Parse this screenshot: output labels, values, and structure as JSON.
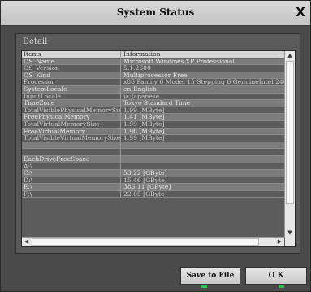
{
  "window": {
    "title": "System Status",
    "close_glyph": "X"
  },
  "panel": {
    "label": "Detail"
  },
  "table": {
    "headers": [
      "Items",
      "Information"
    ],
    "rows": [
      [
        "OS_Name",
        "Microsoft Windows XP Professional"
      ],
      [
        "OS_Version",
        "5.1.2600"
      ],
      [
        "OS_Kind",
        "Multiprocessor Free"
      ],
      [
        "Processor",
        "x86 Family 6 Model 15 Stepping 6 GenuineIntel 2400 Mhz"
      ],
      [
        "SystemLocale",
        "en;English"
      ],
      [
        "InputLocale",
        "ja;Japanese"
      ],
      [
        "TimeZone",
        "Tokyo Standard Time"
      ],
      [
        "TotalVisiblePhysicalMemorySize",
        "1.99 [MByte]"
      ],
      [
        "FreePhysicalMemory",
        "1.41 [MByte]"
      ],
      [
        "TotalVirtualMemorySize",
        "1.99 [MByte]"
      ],
      [
        "FreeVirtualMemory",
        "1.96 [MByte]"
      ],
      [
        "TotalVisibleVirtualMemorySize",
        "1.99 [MByte]"
      ],
      [
        "",
        ""
      ],
      [
        "",
        ""
      ],
      [
        "EachDriveFreeSpace",
        ""
      ],
      [
        "A:\\",
        ""
      ],
      [
        "C:\\",
        "53.22 [GByte]"
      ],
      [
        "D:\\",
        "15.46 [GByte]"
      ],
      [
        "E:\\",
        "386.11 [GByte]"
      ],
      [
        "F:\\",
        "22.05 [GByte]"
      ]
    ]
  },
  "scroll_icons": {
    "up": "▲",
    "down": "▼",
    "left": "◀",
    "right": "▶"
  },
  "buttons": {
    "save": "Save to File",
    "ok": "O K"
  }
}
